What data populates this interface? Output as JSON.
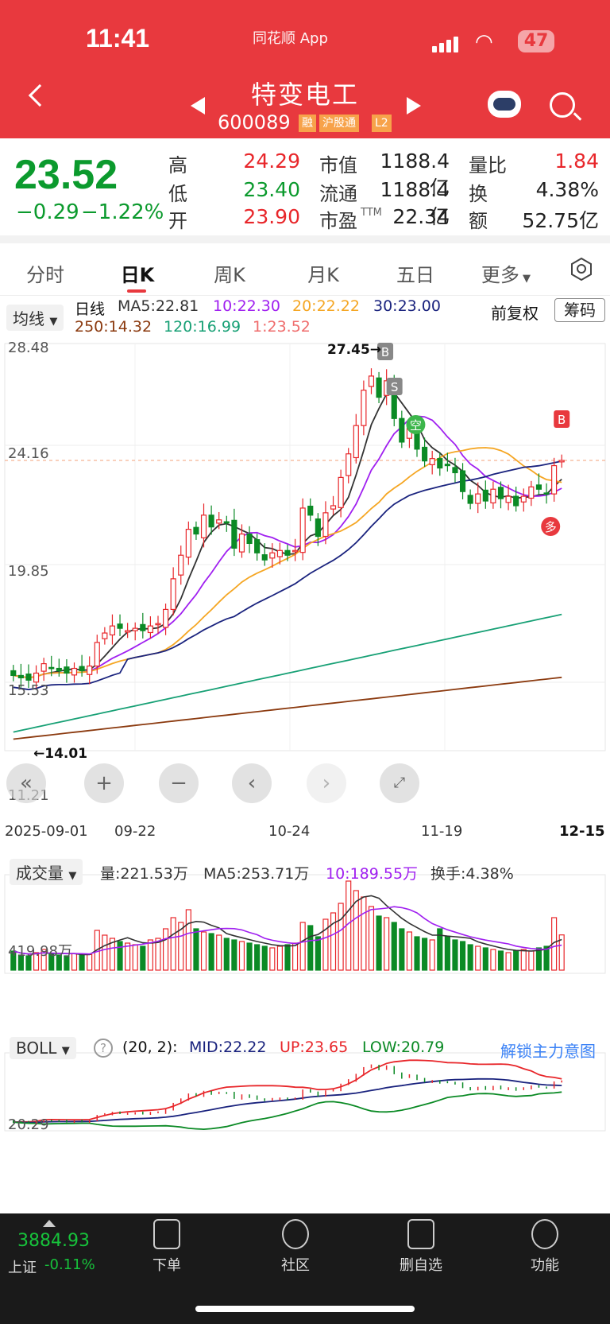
{
  "status": {
    "time": "11:41",
    "app": "同花顺 App",
    "battery": "47"
  },
  "header": {
    "name": "特变电工",
    "code": "600089",
    "tags": [
      "融",
      "沪股通",
      "L2"
    ]
  },
  "quote": {
    "price": "23.52",
    "change": "−0.29",
    "change_pct": "−1.22%",
    "high_label": "高",
    "high": "24.29",
    "low_label": "低",
    "low": "23.40",
    "open_label": "开",
    "open": "23.90",
    "mcap_label": "市值",
    "mcap": "1188.4亿",
    "float_label": "流通",
    "float": "1188.4亿",
    "pe_label": "市盈",
    "pe_sup": "TTM",
    "pe": "22.34",
    "vr_label": "量比",
    "vr": "1.84",
    "turn_label": "换",
    "turn": "4.38%",
    "amt_label": "额",
    "amt": "52.75亿"
  },
  "tabs": [
    {
      "label": "分时"
    },
    {
      "label": "日K"
    },
    {
      "label": "周K"
    },
    {
      "label": "月K"
    },
    {
      "label": "五日"
    },
    {
      "label": "更多"
    }
  ],
  "kline": {
    "selector": "均线",
    "period": "日线",
    "ma5": "MA5:22.81",
    "ma10": "10:22.30",
    "ma20": "20:22.22",
    "ma30": "30:23.00",
    "ma250": "250:14.32",
    "ma120": "120:16.99",
    "ma1": "1:23.52",
    "adjust": "前复权",
    "chips": "筹码",
    "y_labels": [
      "28.48",
      "24.16",
      "19.85",
      "15.53",
      "11.21"
    ],
    "x_labels": [
      "2025-09-01",
      "09-22",
      "10-24",
      "11-19",
      "12-15"
    ],
    "high_marker": "27.45→",
    "low_marker": "←14.01",
    "signals": {
      "buy": "B",
      "sell": "S",
      "short": "空",
      "long": "多"
    }
  },
  "volume": {
    "selector": "成交量",
    "vol": "量:221.53万",
    "ma5": "MA5:253.71万",
    "ma10": "10:189.55万",
    "turnover": "换手:4.38%",
    "y_label": "419.98万"
  },
  "boll": {
    "selector": "BOLL",
    "help": "?",
    "params": "(20, 2):",
    "mid": "MID:22.22",
    "up": "UP:23.65",
    "low": "LOW:20.79",
    "unlock": "解锁主力意图",
    "y_label": "20.29"
  },
  "bottom": {
    "index_value": "3884.93",
    "index_name": "上证",
    "index_change": "-0.11%",
    "nav": [
      {
        "label": "下单"
      },
      {
        "label": "社区"
      },
      {
        "label": "删自选"
      },
      {
        "label": "功能"
      }
    ]
  },
  "colors": {
    "up": "#e8262a",
    "down": "#0b8a25",
    "header": "#e8393e"
  },
  "chart_data": {
    "type": "candlestick",
    "x_range": [
      "2025-09-01",
      "2025-12-15"
    ],
    "ylim": [
      11.21,
      28.48
    ],
    "close": [
      14.4,
      14.3,
      14.2,
      14.5,
      14.9,
      14.7,
      14.6,
      14.5,
      14.7,
      14.6,
      14.8,
      15.8,
      16.2,
      16.5,
      16.4,
      16.3,
      16.4,
      16.3,
      16.5,
      16.6,
      17.2,
      18.5,
      19.5,
      20.6,
      20.4,
      21.2,
      20.7,
      21.0,
      20.9,
      19.8,
      20.4,
      20.0,
      19.6,
      19.3,
      19.6,
      19.7,
      19.5,
      19.7,
      21.5,
      21.2,
      20.3,
      21.3,
      21.6,
      22.8,
      23.8,
      25.0,
      26.5,
      27.1,
      26.2,
      26.9,
      25.3,
      24.3,
      24.9,
      24.0,
      23.5,
      23.6,
      23.2,
      23.3,
      23.0,
      22.2,
      21.7,
      22.1,
      21.8,
      22.3,
      21.9,
      22.0,
      21.6,
      22.0,
      22.4,
      22.3,
      22.1,
      23.3,
      23.52
    ],
    "volume": [
      120,
      95,
      90,
      110,
      130,
      100,
      95,
      90,
      105,
      100,
      98,
      250,
      220,
      200,
      180,
      170,
      160,
      150,
      190,
      200,
      260,
      330,
      300,
      380,
      260,
      240,
      230,
      220,
      200,
      190,
      180,
      170,
      160,
      150,
      140,
      150,
      160,
      170,
      300,
      280,
      210,
      320,
      360,
      420,
      560,
      500,
      460,
      400,
      340,
      330,
      300,
      260,
      240,
      210,
      200,
      190,
      260,
      210,
      190,
      180,
      160,
      150,
      140,
      130,
      120,
      110,
      120,
      130,
      120,
      140,
      150,
      330,
      221.53
    ],
    "series": [
      {
        "name": "MA5",
        "value": "22.81"
      },
      {
        "name": "MA10",
        "value": "22.30"
      },
      {
        "name": "MA20",
        "value": "22.22"
      },
      {
        "name": "MA30",
        "value": "23.00"
      },
      {
        "name": "MA250",
        "value": "14.32"
      },
      {
        "name": "MA120",
        "value": "16.99"
      }
    ]
  }
}
